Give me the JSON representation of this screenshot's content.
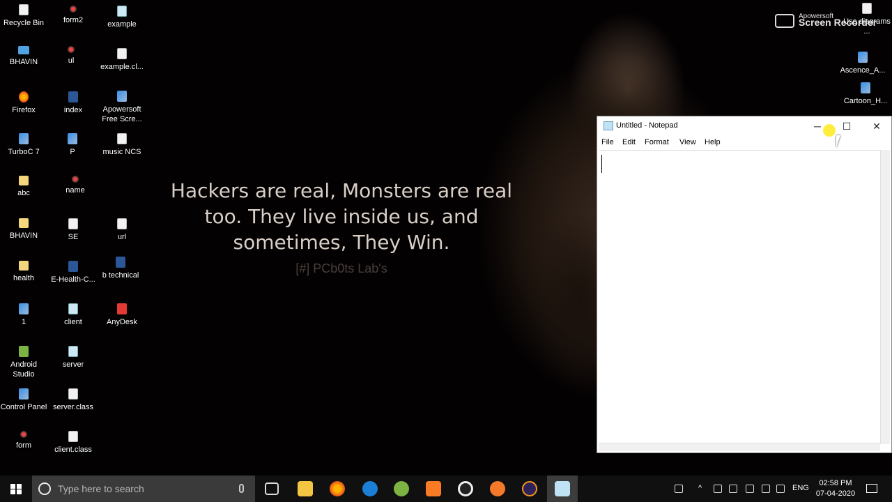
{
  "desktop_icons": [
    {
      "label": "Recycle Bin",
      "kind": "bin"
    },
    {
      "label": "form2",
      "kind": "web"
    },
    {
      "label": "example",
      "kind": "note"
    },
    {
      "label": "BHAVIN",
      "kind": "monitor"
    },
    {
      "label": "ul",
      "kind": "web"
    },
    {
      "label": "example.cl...",
      "kind": "doc"
    },
    {
      "label": "Firefox",
      "kind": "fire"
    },
    {
      "label": "index",
      "kind": "word"
    },
    {
      "label": "Apowersoft Free Scre...",
      "kind": "app"
    },
    {
      "label": "TurboC 7",
      "kind": "app"
    },
    {
      "label": "P",
      "kind": "app"
    },
    {
      "label": "music NCS",
      "kind": "doc"
    },
    {
      "label": "abc",
      "kind": "folder"
    },
    {
      "label": "name",
      "kind": "web"
    },
    {
      "label": "BHAVIN",
      "kind": "folder"
    },
    {
      "label": "SE",
      "kind": "doc"
    },
    {
      "label": "url",
      "kind": "doc"
    },
    {
      "label": "health",
      "kind": "folder"
    },
    {
      "label": "E-Health-C...",
      "kind": "word"
    },
    {
      "label": "b technical",
      "kind": "word"
    },
    {
      "label": "1",
      "kind": "app"
    },
    {
      "label": "client",
      "kind": "note"
    },
    {
      "label": "AnyDesk",
      "kind": "red"
    },
    {
      "label": "Android Studio",
      "kind": "green"
    },
    {
      "label": "server",
      "kind": "note"
    },
    {
      "label": "Control Panel",
      "kind": "app"
    },
    {
      "label": "server.class",
      "kind": "doc"
    },
    {
      "label": "form",
      "kind": "web"
    },
    {
      "label": "client.class",
      "kind": "doc"
    }
  ],
  "right_icons": [
    {
      "label": "Use diagrams ...",
      "kind": "doc"
    },
    {
      "label": "Ascence_A...",
      "kind": "app"
    },
    {
      "label": "Cartoon_H...",
      "kind": "app"
    }
  ],
  "wallpaper": {
    "quote_line1": "Hackers are real, Monsters are real",
    "quote_line2": "too. They live inside us, and",
    "quote_line3": "sometimes, They Win.",
    "signature": "[#] PCb0ts Lab's"
  },
  "watermark": {
    "line1": "Apowersoft",
    "line2": "Screen Recorder"
  },
  "notepad": {
    "title": "Untitled - Notepad",
    "menu": [
      "File",
      "Edit",
      "Format",
      "View",
      "Help"
    ],
    "minimize_glyph": "─",
    "maximize_glyph": "☐",
    "close_glyph": "✕",
    "content": ""
  },
  "taskbar": {
    "search_placeholder": "Type here to search",
    "pinned": [
      "task-view",
      "file-explorer",
      "firefox",
      "edge",
      "android-studio",
      "xampp",
      "obs",
      "blender",
      "eclipse",
      "notepad"
    ],
    "language": "ENG",
    "time": "02:58 PM",
    "date": "07-04-2020"
  },
  "colors": {
    "taskbar_bg": "#101010",
    "search_bg": "#3a3a3a",
    "quote_color": "#d9cfc7"
  }
}
